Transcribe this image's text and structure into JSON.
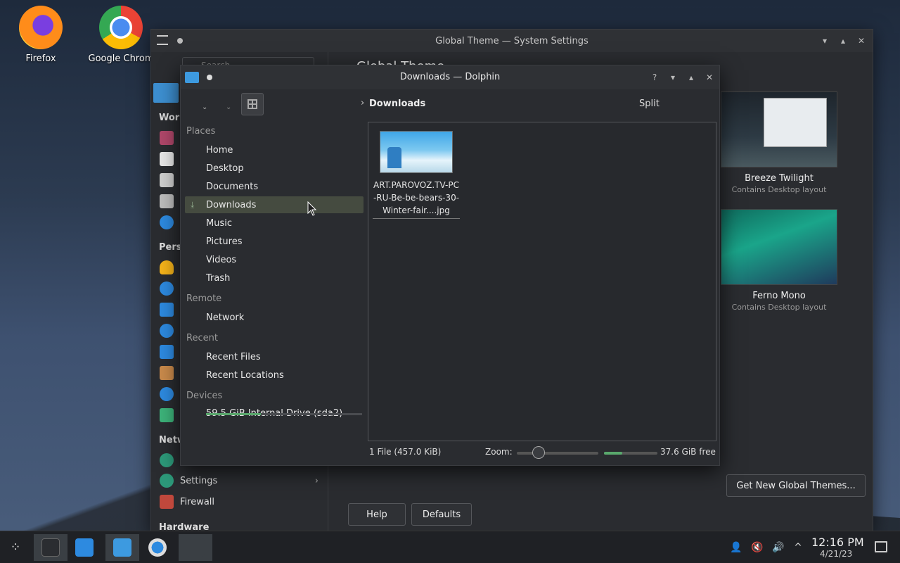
{
  "desktop": {
    "icons": [
      {
        "label": "Firefox"
      },
      {
        "label": "Google Chrom"
      }
    ]
  },
  "system_settings": {
    "title": "Global Theme — System Settings",
    "search_placeholder": "Search",
    "main_title": "Global Theme",
    "categories": {
      "workspace": "Work",
      "personalization": "Perso",
      "network": "Netw",
      "hardware": "Hardware"
    },
    "rows": [
      {
        "label": "Settings"
      },
      {
        "label": "Firewall"
      }
    ],
    "themes": [
      {
        "name": "Breeze Twilight",
        "subtitle": "Contains Desktop layout"
      },
      {
        "name": "Ferno Mono",
        "subtitle": "Contains Desktop layout"
      }
    ],
    "buttons": {
      "get_new": "Get New Global Themes...",
      "help": "Help",
      "defaults": "Defaults"
    }
  },
  "dolphin": {
    "title": "Downloads — Dolphin",
    "breadcrumb": "Downloads",
    "split_label": "Split",
    "places": {
      "header": "Places",
      "items": [
        "Home",
        "Desktop",
        "Documents",
        "Downloads",
        "Music",
        "Pictures",
        "Videos",
        "Trash"
      ]
    },
    "remote": {
      "header": "Remote",
      "items": [
        "Network"
      ]
    },
    "recent": {
      "header": "Recent",
      "items": [
        "Recent Files",
        "Recent Locations"
      ]
    },
    "devices": {
      "header": "Devices",
      "items": [
        "59.5 GiB Internal Drive (sda2)"
      ]
    },
    "file": {
      "name": "ART.PAROVOZ.TV-PC-RU-Be-be-bears-30-Winter-fair....jpg"
    },
    "status": "1 File (457.0 KiB)",
    "zoom_label": "Zoom:",
    "free_space": "37.6 GiB free"
  },
  "taskbar": {
    "time": "12:16 PM",
    "date": "4/21/23"
  },
  "colors": {
    "accent_green": "#59a86c",
    "selection": "#454b40"
  }
}
